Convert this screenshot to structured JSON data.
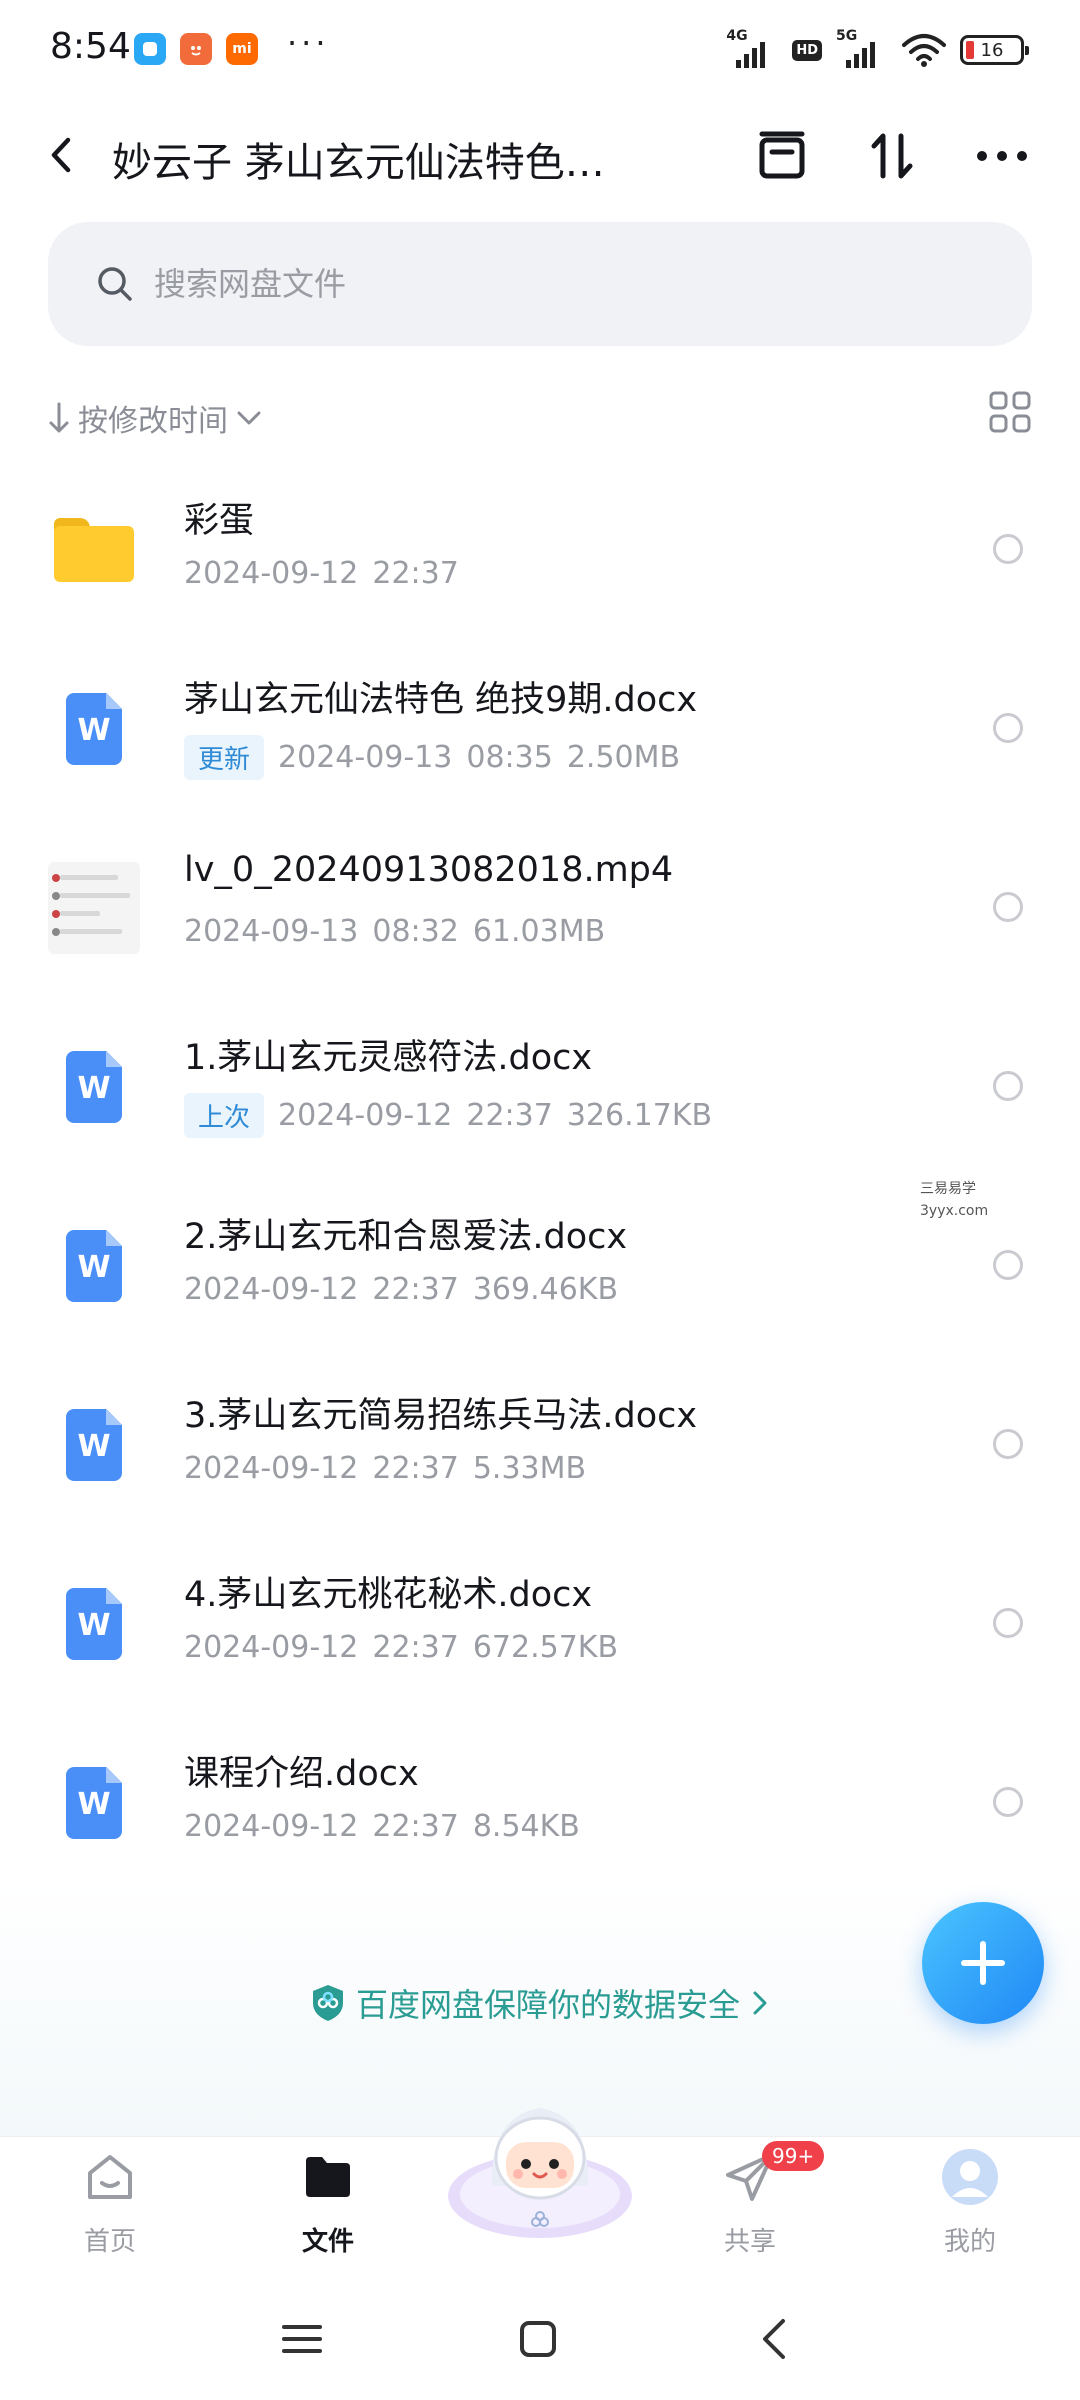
{
  "status_bar": {
    "time": "8:54",
    "dots": "···",
    "net1": "4G",
    "hd": "HD",
    "net2": "5G",
    "battery": "16"
  },
  "header": {
    "title": "妙云子 茅山玄元仙法特色…"
  },
  "search": {
    "placeholder": "搜索网盘文件"
  },
  "sort": {
    "label": "按修改时间"
  },
  "files": [
    {
      "name": "彩蛋",
      "tag": "",
      "date": "2024-09-12",
      "time": "22:37",
      "size": "",
      "type": "folder"
    },
    {
      "name": "茅山玄元仙法特色 绝技9期.docx",
      "tag": "更新",
      "date": "2024-09-13",
      "time": "08:35",
      "size": "2.50MB",
      "type": "docx"
    },
    {
      "name": "lv_0_20240913082018.mp4",
      "tag": "",
      "date": "2024-09-13",
      "time": "08:32",
      "size": "61.03MB",
      "type": "video"
    },
    {
      "name": "1.茅山玄元灵感符法.docx",
      "tag": "上次",
      "date": "2024-09-12",
      "time": "22:37",
      "size": "326.17KB",
      "type": "docx"
    },
    {
      "name": "2.茅山玄元和合恩爱法.docx",
      "tag": "",
      "date": "2024-09-12",
      "time": "22:37",
      "size": "369.46KB",
      "type": "docx"
    },
    {
      "name": "3.茅山玄元简易招练兵马法.docx",
      "tag": "",
      "date": "2024-09-12",
      "time": "22:37",
      "size": "5.33MB",
      "type": "docx"
    },
    {
      "name": "4.茅山玄元桃花秘术.docx",
      "tag": "",
      "date": "2024-09-12",
      "time": "22:37",
      "size": "672.57KB",
      "type": "docx"
    },
    {
      "name": "课程介绍.docx",
      "tag": "",
      "date": "2024-09-12",
      "time": "22:37",
      "size": "8.54KB",
      "type": "docx"
    }
  ],
  "watermark": {
    "line1": "三易易学",
    "line2": "3yyx.com"
  },
  "security_note": "百度网盘保障你的数据安全",
  "tabs": {
    "home": "首页",
    "files": "文件",
    "share": "共享",
    "share_badge": "99+",
    "me": "我的"
  },
  "colors": {
    "accent": "#1f87f5",
    "doc_icon": "#4a8ff7",
    "folder": "#ffcb2e",
    "badge": "#f0414b",
    "secure_text": "#2a9c93"
  }
}
